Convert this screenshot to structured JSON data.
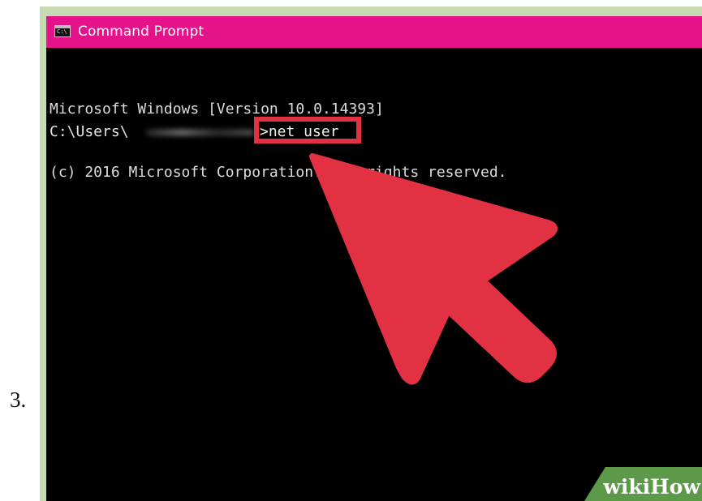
{
  "step": {
    "number": "3."
  },
  "window": {
    "title": "Command Prompt",
    "icon": "cmd-icon",
    "icon_text": "C:\\"
  },
  "console": {
    "lines": [
      "Microsoft Windows [Version 10.0.14393]",
      "(c) 2016 Microsoft Corporation. All rights reserved."
    ],
    "prompt_path": "C:\\Users\\",
    "command": ">net user"
  },
  "annotation": {
    "arrow": "pointer-arrow"
  },
  "watermark": {
    "wiki": "wiki",
    "how": "How"
  },
  "colors": {
    "title_bar": "#e5138a",
    "console_background": "#000000",
    "console_text": "#dcdcdc",
    "highlight_red": "#e33144",
    "frame_green": "#c7dbb3",
    "watermark_green": "#5c9a49"
  }
}
